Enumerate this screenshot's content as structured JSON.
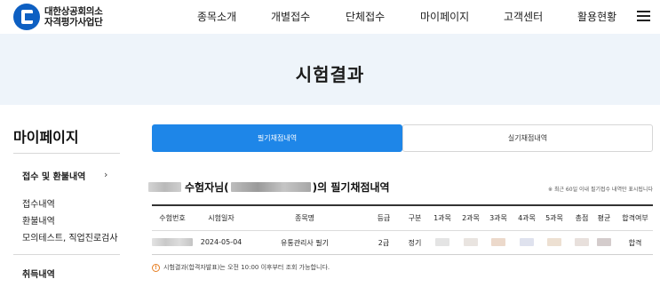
{
  "header": {
    "logo_line1": "대한상공회의소",
    "logo_line2": "자격평가사업단",
    "nav": [
      "종목소개",
      "개별접수",
      "단체접수",
      "마이페이지",
      "고객센터",
      "활용현황"
    ]
  },
  "hero": {
    "title": "시험결과"
  },
  "sidebar": {
    "title": "마이페이지",
    "section1": "접수 및 환불내역",
    "chevron": "›",
    "items": [
      "접수내역",
      "환불내역",
      "모의테스트, 직업진로검사"
    ],
    "section2": "취득내역"
  },
  "tabs": {
    "active": "필기채점내역",
    "inactive": "실기채점내역"
  },
  "section": {
    "title_mid": "수험자님(",
    "title_end": ")의 필기채점내역",
    "note": "※ 최근 60일 이내 필기접수 내역만 표시됩니다"
  },
  "table": {
    "headers": [
      "수험번호",
      "시험일자",
      "종목명",
      "등급",
      "구분",
      "1과목",
      "2과목",
      "3과목",
      "4과목",
      "5과목",
      "총점",
      "평균",
      "합격여부"
    ],
    "row": {
      "date": "2024-05-04",
      "subject": "유통관리사 필기",
      "grade": "2급",
      "type": "정기",
      "result": "합격"
    }
  },
  "notice": {
    "icon": "!",
    "text": "시험결과(합격자발표)는 오전 10:00 이후부터 조회 가능합니다."
  },
  "colors": {
    "primary": "#1e86e8",
    "hero_bg": "#eef4fa",
    "logo_blue": "#0d5fc2"
  }
}
